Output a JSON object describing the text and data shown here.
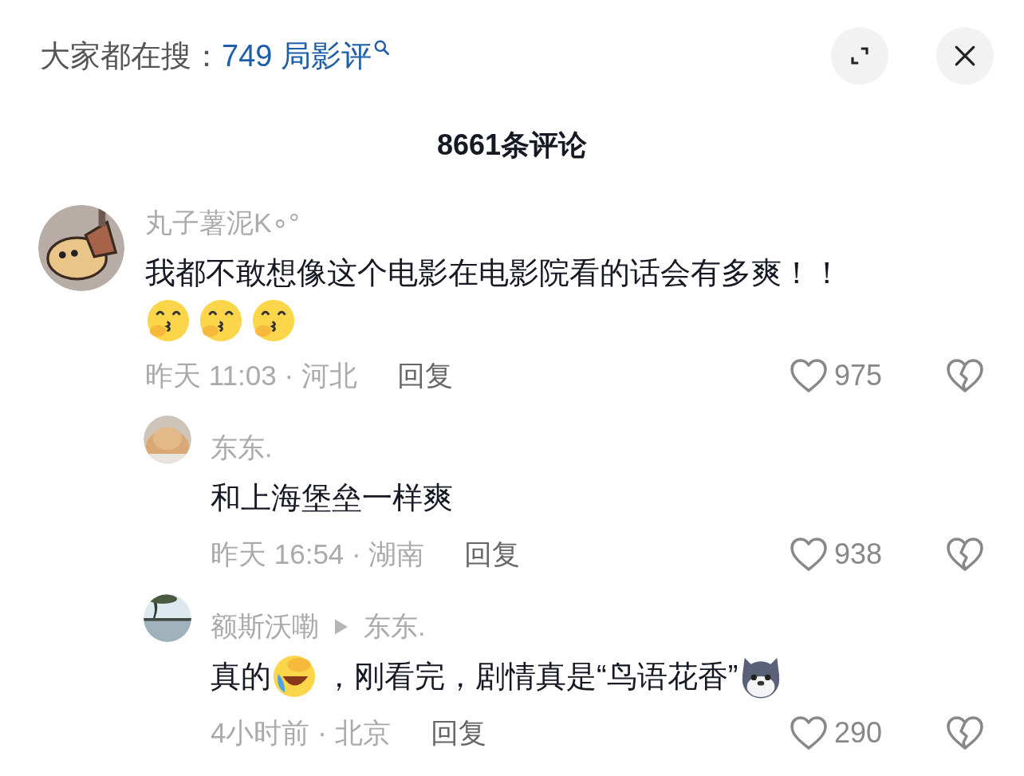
{
  "header": {
    "label": "大家都在搜：",
    "query": "749 局影评"
  },
  "comment_count": "8661条评论",
  "comments": [
    {
      "author": "丸子薯泥K∘°",
      "body": [
        {
          "kind": "text",
          "text": "我都不敢想像这个电影在电影院看的话会有多爽！！"
        },
        {
          "kind": "break"
        },
        {
          "kind": "kiss"
        },
        {
          "kind": "kiss"
        },
        {
          "kind": "kiss"
        }
      ],
      "meta": "昨天 11:03 · 河北",
      "reply": "回复",
      "likes": "975",
      "children": [
        {
          "author": "东东.",
          "body": [
            {
              "kind": "text",
              "text": "和上海堡垒一样爽"
            }
          ],
          "meta": "昨天 16:54 · 湖南",
          "reply": "回复",
          "likes": "938"
        },
        {
          "author": "额斯沃嘞",
          "reply_to": "东东.",
          "body": [
            {
              "kind": "text",
              "text": "真的"
            },
            {
              "kind": "laughcry"
            },
            {
              "kind": "text",
              "text": "，刚看完，剧情真是“鸟语花香”"
            },
            {
              "kind": "husky"
            }
          ],
          "meta": "4小时前 · 北京",
          "reply": "回复",
          "likes": "290"
        }
      ]
    }
  ]
}
